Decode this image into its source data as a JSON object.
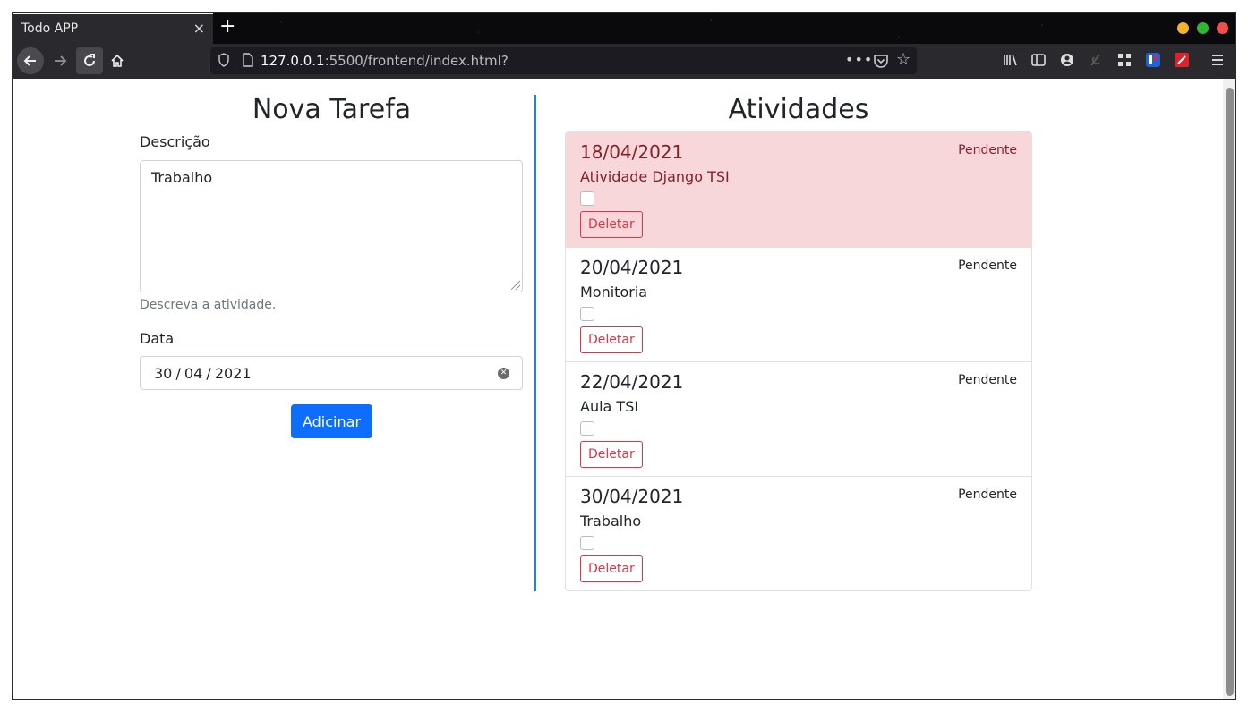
{
  "browser": {
    "tab_title": "Todo APP",
    "tab_close": "×",
    "new_tab": "+",
    "url_host": "127.0.0.1",
    "url_rest": ":5500/frontend/index.html?",
    "url_more": "•••"
  },
  "form": {
    "title": "Nova Tarefa",
    "descricao_label": "Descrição",
    "descricao_value": "Trabalho",
    "descricao_help": "Descreva a atividade.",
    "data_label": "Data",
    "data_value": "30 / 04 / 2021",
    "add_button": "Adicinar"
  },
  "activities": {
    "title": "Atividades",
    "items": [
      {
        "date": "18/04/2021",
        "description": "Atividade Django TSI",
        "status": "Pendente",
        "delete": "Deletar",
        "highlight": true
      },
      {
        "date": "20/04/2021",
        "description": "Monitoria",
        "status": "Pendente",
        "delete": "Deletar",
        "highlight": false
      },
      {
        "date": "22/04/2021",
        "description": "Aula TSI",
        "status": "Pendente",
        "delete": "Deletar",
        "highlight": false
      },
      {
        "date": "30/04/2021",
        "description": "Trabalho",
        "status": "Pendente",
        "delete": "Deletar",
        "highlight": false
      }
    ]
  },
  "colors": {
    "primary": "#0d6efd",
    "danger": "#dc3545",
    "danger_bg": "#f8d7da",
    "divider": "#3b7ea8"
  }
}
